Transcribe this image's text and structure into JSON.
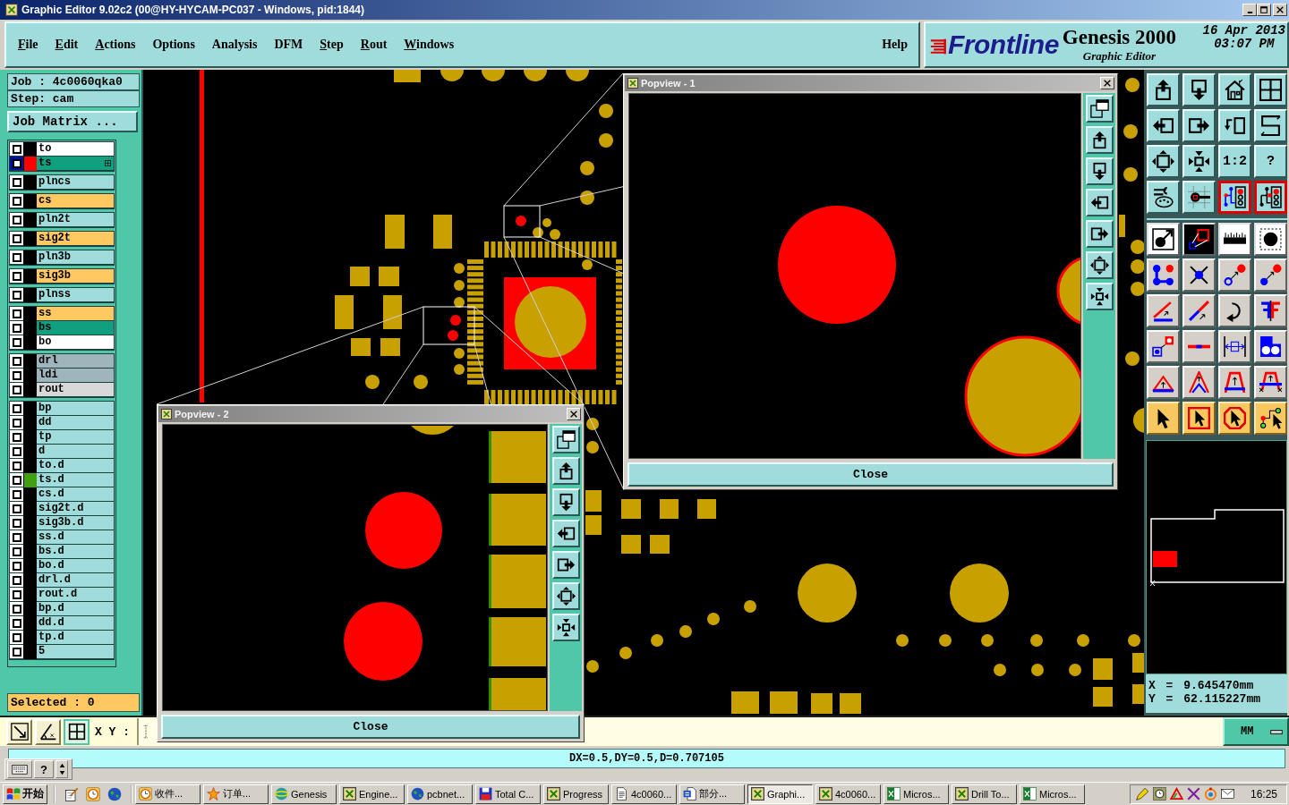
{
  "window": {
    "title": "Graphic Editor 9.02c2 (00@HY-HYCAM-PC037 - Windows, pid:1844)"
  },
  "menu": {
    "items": [
      {
        "label": "File",
        "mnemonic": true
      },
      {
        "label": "Edit",
        "mnemonic": true
      },
      {
        "label": "Actions",
        "mnemonic": true
      },
      {
        "label": "Options",
        "mnemonic": false
      },
      {
        "label": "Analysis",
        "mnemonic": false
      },
      {
        "label": "DFM",
        "mnemonic": false
      },
      {
        "label": "Step",
        "mnemonic": true
      },
      {
        "label": "Rout",
        "mnemonic": true
      },
      {
        "label": "Windows",
        "mnemonic": true
      }
    ],
    "help": {
      "label": "Help",
      "mnemonic": false
    }
  },
  "brand": {
    "logo": "Frontline",
    "product": "Genesis 2000",
    "subtitle": "Graphic Editor",
    "date": "16 Apr 2013",
    "time": "03:07 PM"
  },
  "job_panel": {
    "job": "Job : 4c0060qka0",
    "step": "Step: cam",
    "matrix_button": "Job Matrix ...",
    "layer_groups": [
      {
        "layers": [
          {
            "name": "to",
            "color": "#ffffff",
            "checked": false,
            "selected": false
          },
          {
            "name": "ts",
            "color": "#10a080",
            "checked": false,
            "selected": true,
            "swatch": {
              "color": "#ff0000"
            }
          }
        ]
      },
      {
        "layers": [
          {
            "name": "plncs",
            "color": "#a0dcdc",
            "checked": false,
            "selected": false
          }
        ]
      },
      {
        "layers": [
          {
            "name": "cs",
            "color": "#ffc860",
            "checked": false,
            "selected": false
          }
        ]
      },
      {
        "layers": [
          {
            "name": "pln2t",
            "color": "#a0dcdc",
            "checked": false,
            "selected": false
          }
        ]
      },
      {
        "layers": [
          {
            "name": "sig2t",
            "color": "#ffc860",
            "checked": false,
            "selected": false
          }
        ]
      },
      {
        "layers": [
          {
            "name": "pln3b",
            "color": "#a0dcdc",
            "checked": false,
            "selected": false
          }
        ]
      },
      {
        "layers": [
          {
            "name": "sig3b",
            "color": "#ffc860",
            "checked": false,
            "selected": false
          }
        ]
      },
      {
        "layers": [
          {
            "name": "plnss",
            "color": "#a0dcdc",
            "checked": false,
            "selected": false
          }
        ]
      },
      {
        "layers": [
          {
            "name": "ss",
            "color": "#ffc860",
            "checked": false,
            "selected": false
          },
          {
            "name": "bs",
            "color": "#10a080",
            "checked": false,
            "selected": false
          },
          {
            "name": "bo",
            "color": "#ffffff",
            "checked": false,
            "selected": false
          }
        ]
      },
      {
        "layers": [
          {
            "name": "drl",
            "color": "#a0b4bc",
            "checked": false,
            "selected": false
          },
          {
            "name": "ldi",
            "color": "#a0b4bc",
            "checked": false,
            "selected": false
          },
          {
            "name": "rout",
            "color": "#d8d8d8",
            "checked": false,
            "selected": false
          }
        ]
      },
      {
        "layers": [
          {
            "name": "bp",
            "color": "#a0dcdc",
            "checked": false,
            "selected": false
          },
          {
            "name": "dd",
            "color": "#a0dcdc",
            "checked": false,
            "selected": false
          },
          {
            "name": "tp",
            "color": "#a0dcdc",
            "checked": false,
            "selected": false
          },
          {
            "name": "d",
            "color": "#a0dcdc",
            "checked": false,
            "selected": false
          },
          {
            "name": "to.d",
            "color": "#a0dcdc",
            "checked": false,
            "selected": false
          },
          {
            "name": "ts.d",
            "color": "#a0dcdc",
            "checked": false,
            "selected": false,
            "swatch": {
              "color": "#40a010"
            }
          },
          {
            "name": "cs.d",
            "color": "#a0dcdc",
            "checked": false,
            "selected": false
          },
          {
            "name": "sig2t.d",
            "color": "#a0dcdc",
            "checked": false,
            "selected": false
          },
          {
            "name": "sig3b.d",
            "color": "#a0dcdc",
            "checked": false,
            "selected": false
          },
          {
            "name": "ss.d",
            "color": "#a0dcdc",
            "checked": false,
            "selected": false
          },
          {
            "name": "bs.d",
            "color": "#a0dcdc",
            "checked": false,
            "selected": false
          },
          {
            "name": "bo.d",
            "color": "#a0dcdc",
            "checked": false,
            "selected": false
          },
          {
            "name": "drl.d",
            "color": "#a0dcdc",
            "checked": false,
            "selected": false
          },
          {
            "name": "rout.d",
            "color": "#a0dcdc",
            "checked": false,
            "selected": false
          },
          {
            "name": "bp.d",
            "color": "#a0dcdc",
            "checked": false,
            "selected": false
          },
          {
            "name": "dd.d",
            "color": "#a0dcdc",
            "checked": false,
            "selected": false
          },
          {
            "name": "tp.d",
            "color": "#a0dcdc",
            "checked": false,
            "selected": false
          },
          {
            "name": "5",
            "color": "#a0dcdc",
            "checked": false,
            "selected": false
          }
        ]
      }
    ],
    "selected": "Selected : 0"
  },
  "popviews": [
    {
      "title": "Popview - 1",
      "close_button": "Close"
    },
    {
      "title": "Popview - 2",
      "close_button": "Close"
    }
  ],
  "toolbar": {
    "view_tools": [
      {
        "active": false
      },
      {
        "active": false
      },
      {
        "active": false
      },
      {
        "active": false
      },
      {
        "active": false
      },
      {
        "active": false
      },
      {
        "active": false
      },
      {
        "active": false
      },
      {
        "active": false
      },
      {
        "active": false
      },
      {
        "label": "1:2",
        "active": false
      },
      {
        "label": "?",
        "active": false
      },
      {
        "active": false
      },
      {
        "active": false
      },
      {
        "active": true
      },
      {
        "active": true
      }
    ],
    "edit_tools": [
      {
        "active": false
      },
      {
        "active": false
      },
      {
        "active": false
      },
      {
        "active": false
      },
      {
        "active": false
      },
      {
        "active": false
      },
      {
        "active": false
      },
      {
        "active": false
      },
      {
        "active": false
      },
      {
        "active": false
      },
      {
        "active": false
      },
      {
        "active": false
      },
      {
        "active": false
      },
      {
        "active": false
      },
      {
        "active": false
      },
      {
        "active": false
      },
      {
        "active": false
      },
      {
        "active": false
      },
      {
        "active": false
      },
      {
        "active": false
      },
      {
        "active": false
      },
      {
        "active": false
      },
      {
        "active": false
      },
      {
        "active": false
      }
    ]
  },
  "coordinates": {
    "x": "X = 9.645470mm",
    "y": "Y = 62.115227mm"
  },
  "input_bar": {
    "tools": [
      {
        "selected": false
      },
      {
        "selected": false
      },
      {
        "selected": true
      }
    ],
    "label": "X Y :",
    "units_button": "MM"
  },
  "status_bar": {
    "text": "DX=0.5,DY=0.5,D=0.707105",
    "help_button": "?"
  },
  "taskbar": {
    "start": "开始",
    "buttons": [
      {
        "label": "收件...",
        "selected": false
      },
      {
        "label": "订单...",
        "selected": false
      },
      {
        "label": "Genesis",
        "selected": false
      },
      {
        "label": "Engine...",
        "selected": false
      },
      {
        "label": "pcbnet...",
        "selected": false
      },
      {
        "label": "Total C...",
        "selected": false
      },
      {
        "label": "Progress",
        "selected": false
      },
      {
        "label": "4c0060...",
        "selected": false
      },
      {
        "label": "部分...",
        "selected": false
      },
      {
        "label": "Graphi...",
        "selected": true
      },
      {
        "label": "4c0060...",
        "selected": false
      },
      {
        "label": "Micros...",
        "selected": false
      },
      {
        "label": "Drill To...",
        "selected": false
      },
      {
        "label": "Micros...",
        "selected": false
      }
    ],
    "clock": "16:25"
  }
}
